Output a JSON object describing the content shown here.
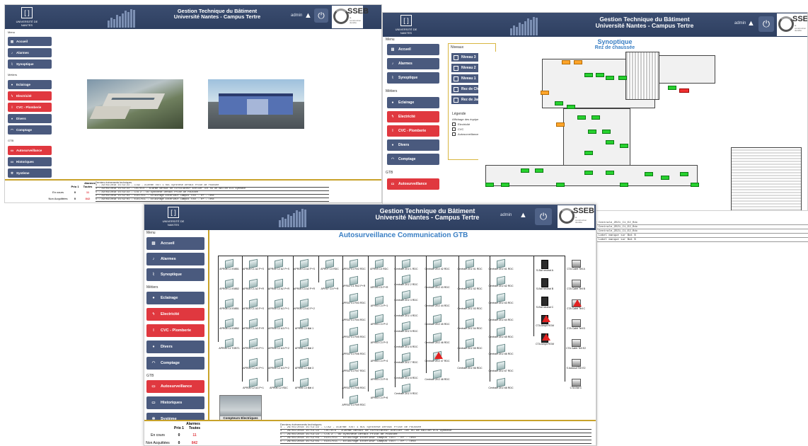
{
  "header": {
    "logo_label": "UNIVERSITÉ DE NANTES",
    "title_line1": "Gestion Technique du Bâtiment",
    "title_line2": "Université Nantes - Campus Tertre",
    "user_a": "admin",
    "user_b": "admin",
    "user_c": "admin",
    "brand": "SSEB",
    "brand_sub": "la construction durable"
  },
  "nav": {
    "section_main": "Menu",
    "accueil": "Accueil",
    "alarmes": "Alarmes",
    "synoptique": "Synoptique",
    "section_metiers": "Métiers",
    "eclairage": "Eclairage",
    "electricite": "Electricité",
    "cvc": "CVC - Plomberie",
    "divers": "Divers",
    "comptage": "Comptage",
    "section_gtb": "GTB",
    "autosurveillance": "Autosurveillance",
    "historiques": "Historiques",
    "systeme": "Système"
  },
  "alarms": {
    "title": "Alarmes",
    "col_prio": "Prio 1",
    "col_all": "Toutes",
    "row_encours": "En cours",
    "row_nonacq": "Non Acquittées",
    "a_encours_prio": "0",
    "a_encours_all": "11",
    "a_nonacq_prio": "0",
    "a_nonacq_all": "842",
    "c_encours_prio": "0",
    "c_encours_all": "11",
    "c_nonacq_prio": "0",
    "c_nonacq_all": "842"
  },
  "events": {
    "title": "Derniers événements techniques",
    "rows": [
      "4 - 29/03/2018 15:53:22 - CTA2 - Alarme TOUT 1 RDC Synthèse Défaut Prise de Poussée",
      "4 - 29/03/2018 15:53:22 - CVC/ECS - Alarme défaut de circulateur Atelier lot nu de Ballon ECS Gymnase",
      "5 - 29/03/2018 15:53:22 - CTA 2 - OD Synthèse Défaut Prise de Poussée",
      "5 - 29/03/2018 15:52:03 - ÉLEC/ÉCL - Eclairage Extérieur Campus TOUT - R+ - Test",
      "5 - 29/03/2018 15:52:01 - ÉLEC/ÉCL - Eclairage Extérieur Campus TOUT - R+ - Test"
    ]
  },
  "synoptique": {
    "title": "Synoptique",
    "subtitle": "Rez de chaussée",
    "levels": [
      "Niveau 3",
      "Niveau 2",
      "Niveau 1",
      "Rez de Chaussée",
      "Rez de Jardin"
    ],
    "legend_title": "Légende",
    "legend_sub": "Affichage des équipements :",
    "legend_items": [
      "Electricité",
      "CVC",
      "Autosurveillance"
    ]
  },
  "autosurv": {
    "title": "Autosurveillance Communication GTB",
    "compteurs": "Compteurs Electriques",
    "col1": [
      "APR08 C1 EI8B1",
      "APR09 C1 EI8B2",
      "APR08 C4 EI8B1",
      "APR08 C4 EI8B2",
      "APR06 C4 TGBT1"
    ],
    "col2": [
      "APR06 C1 A2 P+S",
      "APR06 C1 A2 P+R",
      "APR06 C1 A3 P+S",
      "APR06 C1 A3 P+R",
      "APR06 C1 A3 P+1",
      "APR06 C2 A2 P+1",
      "APR06 C2 A3 P+1"
    ],
    "col3": [
      "APR06 C2 A2 P+S",
      "APR06 C2 A2 P+R",
      "APR06 C2 A2 P+1",
      "APR06 C2 A3 P+1",
      "APR06 C2 A3 P+2",
      "APR06 C2 A3 P+2",
      "APR06 C2 RDC"
    ],
    "col4": [
      "APR06 C3 A2 P+S",
      "APR06 C3 A2 P+R",
      "APR06 C3 A2 P+2",
      "APR06 C3 Bât 1",
      "APR06 C3 Bât 2",
      "APR06 C3 Bât 3",
      "APR06 C3 Bât 4"
    ],
    "col5": [
      "APR07 C3 RDC",
      "APR07 C3 P+R"
    ],
    "col6": [
      "APR02 C1 R02 RDC",
      "APR02 C1 R02 P+R",
      "APR02 C1 R03 RDC",
      "APR02 C1 R04 RDC",
      "APR02 C1 R05 RDC",
      "APR02 C1 R06 RDC",
      "APR02 C1 R07 RDC",
      "APR02 C1 R08 RDC",
      "APR02 C1 R09 RDC"
    ],
    "col7": [
      "APR03 C3 RDC",
      "APR03 C3 P+R",
      "APR03 C3 P+1",
      "APR03 C3 P+2",
      "APR03 C3 P+3",
      "APR03 C3 P+4",
      "APR03 C3 P+5",
      "APR03 C3 P+6"
    ],
    "col8": [
      "Centrale ZEZ 1 RDC",
      "Centrale ZEZ 2 RDC",
      "Centrale ZEZ 3 RDC",
      "Centrale ZEZ 4 RDC",
      "Centrale ZEZ 5 RDC",
      "Centrale ZEZ 6 RDC",
      "Centrale ZEZ 7 RDC",
      "Centrale ZEZ 8 RDC",
      "Centrale ZEZ 9 RDC"
    ],
    "col9": [
      "Centrale ZEZ 42 RDC",
      "Centrale ZEZ 43 RDC",
      "Centrale ZEZ 44 RDC",
      "Centrale ZEZ 45 RDC",
      "Centrale ZEZ 46 RDC",
      "Centrale ZEZ 47 RDC",
      "Centrale ZEZ 48 RDC"
    ],
    "col10": [
      "Centrale ZEZ 51 RDC",
      "Centrale ZEZ 52 RDC",
      "Centrale ZEZ 53 RDC",
      "Centrale ZEZ 54 RDC",
      "Centrale ZEZ 55 RDC",
      "Centrale ZEZ 56 RDC"
    ],
    "col11": [
      "Centrale ZEZ 61 RDC",
      "Centrale ZEZ 62 RDC",
      "Centrale ZEZ 63 RDC",
      "Centrale ZEZ 64 RDC",
      "Centrale ZEZ 65 RDC",
      "Centrale ZEZ 66 RDC",
      "Centrale ZEZ 67 RDC",
      "Centrale ZEZ 68 RDC"
    ],
    "col12": [
      "S-Bat neutral A",
      "S-Bat neutral B",
      "S-Bat neutral C",
      "CTA Ampli RGM",
      "CTA Ampli RGM"
    ],
    "col13": [
      "CTA Cafet Tell A",
      "CTA Cafet Tell B",
      "CTA Cafet Tell C",
      "CTA Cafet Tell D",
      "CTA Cafet Tell E2",
      "S Autosuf Tell E2",
      "CTA Bât C"
    ]
  },
  "side_panel": [
    "Centrale_ZEZ1_C1_E2_Rdc",
    "Centrale_ZEZ1_C1_E2_Rdc",
    "Centrale_ZEZ1_C1_E2_Rdc",
    "Label manque sur Bat B",
    "Label manque sur Bat B"
  ]
}
